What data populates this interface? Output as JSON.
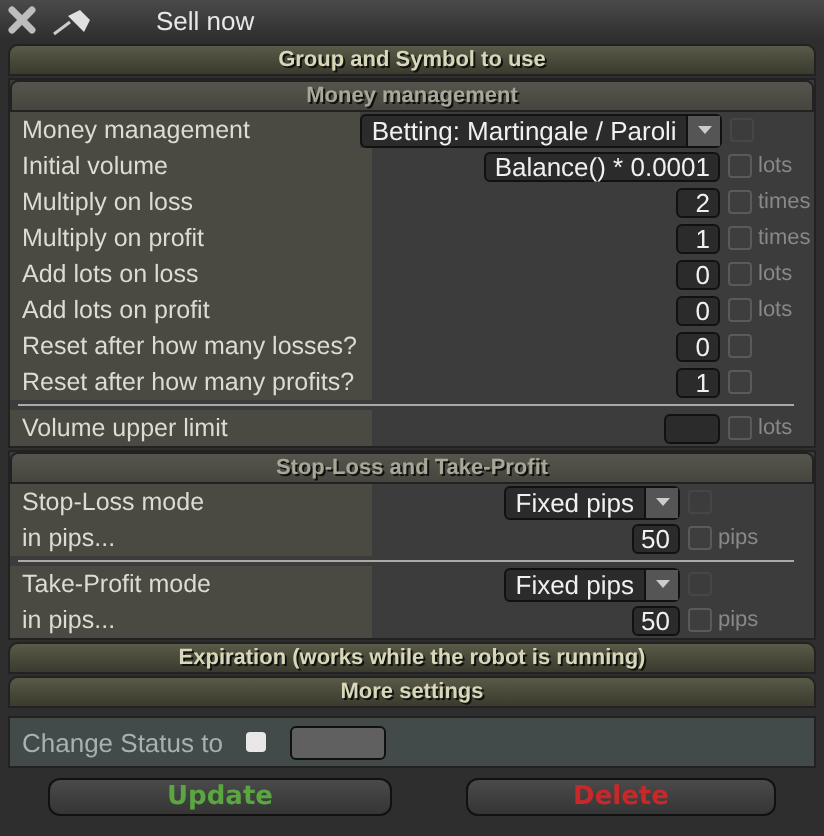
{
  "window": {
    "title": "Sell now"
  },
  "sections": [
    {
      "kind": "header",
      "title": "Group and Symbol to use"
    },
    {
      "kind": "group",
      "title": "Money management",
      "blocks": [
        [
          {
            "kind": "dropdown",
            "label": "Money management",
            "value": "Betting: Martingale / Paroli",
            "checked": false
          },
          {
            "kind": "input",
            "label": "Initial volume",
            "value": "Balance() * 0.0001",
            "checked": false,
            "unit": "lots"
          },
          {
            "kind": "input",
            "label": "Multiply on loss",
            "value": "2",
            "checked": false,
            "unit": "times"
          },
          {
            "kind": "input",
            "label": "Multiply on profit",
            "value": "1",
            "checked": false,
            "unit": "times"
          },
          {
            "kind": "input",
            "label": "Add lots on loss",
            "value": "0",
            "checked": false,
            "unit": "lots"
          },
          {
            "kind": "input",
            "label": "Add lots on profit",
            "value": "0",
            "checked": false,
            "unit": "lots"
          },
          {
            "kind": "input",
            "label": "Reset after how many losses?",
            "value": "0",
            "checked": false
          },
          {
            "kind": "input",
            "label": "Reset after how many profits?",
            "value": "1",
            "checked": false
          }
        ],
        [
          {
            "kind": "input",
            "label": "Volume upper limit",
            "checked": false,
            "unit": "lots"
          }
        ]
      ]
    },
    {
      "kind": "group",
      "title": "Stop-Loss and Take-Profit",
      "blocks": [
        [
          {
            "kind": "dropdown",
            "label": "Stop-Loss mode",
            "value": "Fixed pips",
            "checked": false
          },
          {
            "kind": "input",
            "label": "in pips...",
            "value": "50",
            "checked": false,
            "unit": "pips"
          }
        ],
        [
          {
            "kind": "dropdown",
            "label": "Take-Profit mode",
            "value": "Fixed pips",
            "checked": false
          },
          {
            "kind": "input",
            "label": "in pips...",
            "value": "50",
            "checked": false,
            "unit": "pips"
          }
        ]
      ]
    },
    {
      "kind": "header",
      "title": "Expiration (works while the robot is running)"
    },
    {
      "kind": "header",
      "title": "More settings"
    }
  ],
  "status": {
    "label": "Change Status to",
    "checked": false
  },
  "buttons": [
    {
      "label": "Update",
      "kind": "confirm"
    },
    {
      "label": "Delete",
      "kind": "danger"
    }
  ]
}
